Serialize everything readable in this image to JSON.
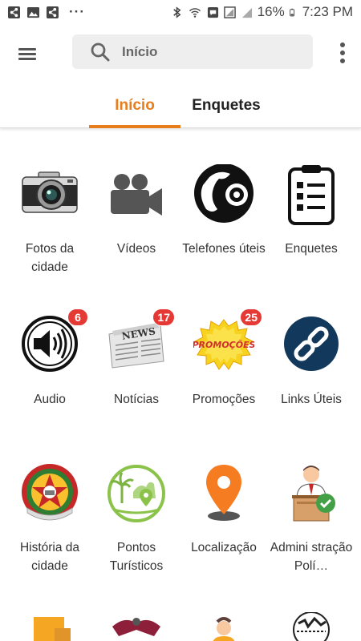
{
  "status_bar": {
    "battery": "16%",
    "time": "7:23 PM",
    "more": "···"
  },
  "search": {
    "placeholder": "Início"
  },
  "tabs": [
    {
      "label": "Início",
      "active": true
    },
    {
      "label": "Enquetes",
      "active": false
    }
  ],
  "accent_color": "#e87d1e",
  "grid": [
    {
      "label": "Fotos da cidade",
      "icon": "camera-icon",
      "badge": ""
    },
    {
      "label": "Vídeos",
      "icon": "video-camera-icon",
      "badge": ""
    },
    {
      "label": "Telefones úteis",
      "icon": "telephone-icon",
      "badge": ""
    },
    {
      "label": "Enquetes",
      "icon": "clipboard-icon",
      "badge": ""
    },
    {
      "label": "Audio",
      "icon": "speaker-icon",
      "badge": "6"
    },
    {
      "label": "Notícias",
      "icon": "newspaper-icon",
      "badge": "17"
    },
    {
      "label": "Promoções",
      "icon": "promo-icon",
      "badge": "25"
    },
    {
      "label": "Links Úteis",
      "icon": "link-icon",
      "badge": ""
    },
    {
      "label": "História da cidade",
      "icon": "city-crest-icon",
      "badge": ""
    },
    {
      "label": "Pontos Turísticos",
      "icon": "tourism-icon",
      "badge": ""
    },
    {
      "label": "Localização",
      "icon": "location-pin-icon",
      "badge": ""
    },
    {
      "label": "Admini stração Polí…",
      "icon": "administration-icon",
      "badge": ""
    }
  ]
}
